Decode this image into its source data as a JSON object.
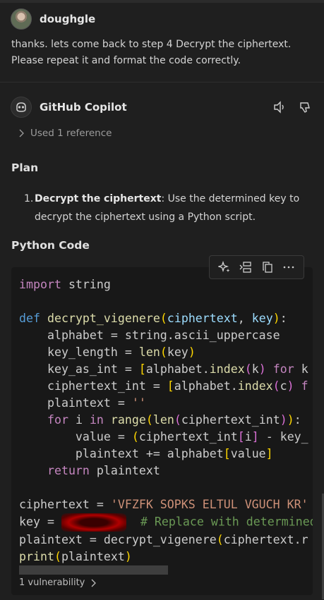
{
  "user": {
    "name": "doughgle",
    "message": "thanks. lets come back to step 4 Decrypt the ciphertext. Please repeat it and format the code correctly."
  },
  "copilot": {
    "name": "GitHub Copilot",
    "icons": [
      "speaker-icon",
      "thumbs-down-icon"
    ]
  },
  "reference": {
    "label": "Used 1 reference"
  },
  "plan": {
    "heading": "Plan",
    "items": [
      {
        "number": "1.",
        "title": "Decrypt the ciphertext",
        "description": ": Use the determined key to decrypt the ciphertext using a Python script."
      }
    ]
  },
  "python_section": {
    "heading": "Python Code"
  },
  "code_toolbar": {
    "icons": [
      "sparkle-icon",
      "insert-icon",
      "copy-icon",
      "more-icon"
    ]
  },
  "code": {
    "t_import": "import",
    "t_string": " string",
    "t_def": "def",
    "t_fname": "decrypt_vigenere",
    "t_p1": "ciphertext",
    "t_p2": "key",
    "t_alpha": "    alphabet = string.ascii_uppercase",
    "t_kl1": "    key_length = ",
    "t_len": "len",
    "t_kl2": "key",
    "t_kai1": "    key_as_int = ",
    "t_kai2": "alphabet.",
    "t_index": "index",
    "t_kai3": "k",
    "t_for": "for",
    "t_kai4": " k",
    "t_ci1": "    ciphertext_int = ",
    "t_ci2": "alphabet.",
    "t_ci3": "c",
    "t_ci4": "f",
    "t_pt1": "    plaintext = ",
    "t_pt2": "''",
    "t_for2": "for",
    "t_fi1": " i ",
    "t_in": "in",
    "t_range": "range",
    "t_fi2": "ciphertext_int",
    "t_val1": "        value = ",
    "t_val2": "ciphertext_int",
    "t_val3": "i",
    "t_val4": " - key_",
    "t_pa1": "        plaintext += alphabet",
    "t_pa2": "value",
    "t_ret": "return",
    "t_ret2": " plaintext",
    "t_ct1": "ciphertext = ",
    "t_ct2": "'VFZFK SOPKS ELTUL VGUCH KR'",
    "t_key1": "key = ",
    "t_keycm": "# Replace with determined",
    "t_pl1": "plaintext = decrypt_vigenere",
    "t_pl2": "ciphertext.r",
    "t_print": "print",
    "t_pr2": "plaintext"
  },
  "vulnerability": {
    "label": "1 vulnerability"
  }
}
